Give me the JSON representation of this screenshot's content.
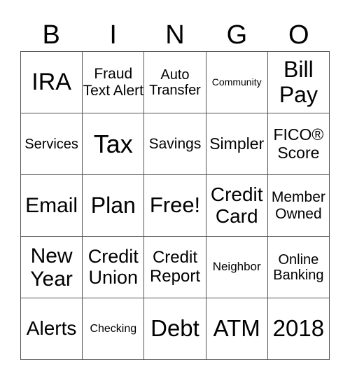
{
  "header": [
    "B",
    "I",
    "N",
    "G",
    "O"
  ],
  "cells": [
    {
      "text": "IRA",
      "size": 34
    },
    {
      "text": "Fraud Text Alert",
      "size": 21
    },
    {
      "text": "Auto Transfer",
      "size": 20
    },
    {
      "text": "Community",
      "size": 14
    },
    {
      "text": "Bill Pay",
      "size": 32
    },
    {
      "text": "Services",
      "size": 20
    },
    {
      "text": "Tax",
      "size": 36
    },
    {
      "text": "Savings",
      "size": 21
    },
    {
      "text": "Simpler",
      "size": 23
    },
    {
      "text": "FICO® Score",
      "size": 23
    },
    {
      "text": "Email",
      "size": 30
    },
    {
      "text": "Plan",
      "size": 32
    },
    {
      "text": "Free!",
      "size": 31
    },
    {
      "text": "Credit Card",
      "size": 28
    },
    {
      "text": "Member Owned",
      "size": 21
    },
    {
      "text": "New Year",
      "size": 30
    },
    {
      "text": "Credit Union",
      "size": 27
    },
    {
      "text": "Credit Report",
      "size": 24
    },
    {
      "text": "Neighbor",
      "size": 17
    },
    {
      "text": "Online Banking",
      "size": 20
    },
    {
      "text": "Alerts",
      "size": 28
    },
    {
      "text": "Checking",
      "size": 16
    },
    {
      "text": "Debt",
      "size": 33
    },
    {
      "text": "ATM",
      "size": 33
    },
    {
      "text": "2018",
      "size": 33
    }
  ]
}
